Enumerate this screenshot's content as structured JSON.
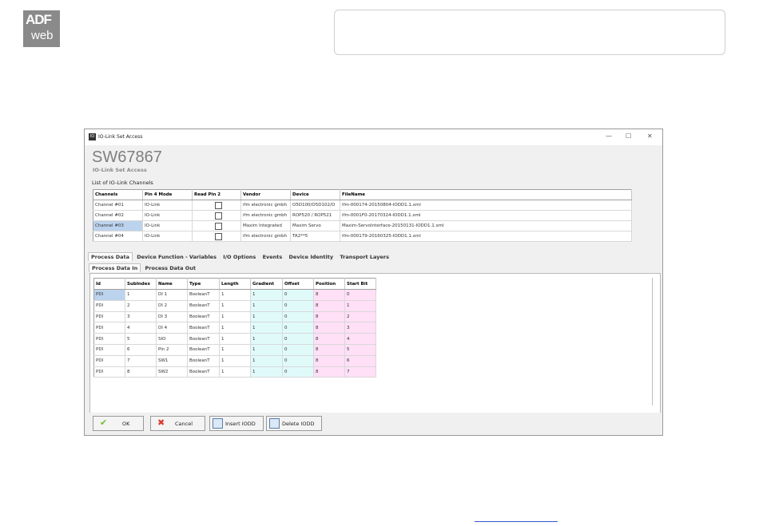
{
  "logo": {
    "line1": "ADF",
    "line2": "web"
  },
  "window": {
    "title": "IO-Link Set Access",
    "app_icon": "IO",
    "controls": [
      "—",
      "☐",
      "✕"
    ],
    "product_code": "SW67867",
    "product_subtitle": "IO-Link Set Access",
    "list_label": "List of IO-Link Channels"
  },
  "channels": {
    "headers": [
      "Channels",
      "Pin 4 Mode",
      "Read Pin 2",
      "Vendor",
      "Device",
      "FileName"
    ],
    "rows": [
      {
        "channel": "Channel #01",
        "mode": "IO-Link",
        "vendor": "ifm electronic gmbh",
        "device": "O5D100/O5D102/O",
        "file": "ifm-000174-20150804-IODD1.1.xml"
      },
      {
        "channel": "Channel #02",
        "mode": "IO-Link",
        "vendor": "ifm electronic gmbh",
        "device": "ROP520 / ROP521",
        "file": "ifm-0001F0-20170324-IODD1.1.xml"
      },
      {
        "channel": "Channel #03",
        "mode": "IO-Link",
        "vendor": "Maxim Integrated",
        "device": "Maxim Servo",
        "file": "Maxim-ServoInterface-20150131-IODD1.1.xml"
      },
      {
        "channel": "Channel #04",
        "mode": "IO-Link",
        "vendor": "ifm electronic gmbh",
        "device": "TA2**5",
        "file": "ifm-000179-20160325-IODD1.1.xml"
      }
    ]
  },
  "tabs": [
    "Process Data",
    "Device Function - Variables",
    "I/O Options",
    "Events",
    "Device Identity",
    "Transport Layers"
  ],
  "subtabs": [
    "Process Data In",
    "Process Data Out"
  ],
  "process_data": {
    "headers": [
      "Id",
      "SubIndex",
      "Name",
      "Type",
      "Length",
      "Gradient",
      "Offset",
      "Position",
      "Start Bit"
    ],
    "rows": [
      [
        "PDI",
        "1",
        "DI 1",
        "BooleanT",
        "1",
        "1",
        "0",
        "8",
        "0"
      ],
      [
        "PDI",
        "2",
        "DI 2",
        "BooleanT",
        "1",
        "1",
        "0",
        "8",
        "1"
      ],
      [
        "PDI",
        "3",
        "DI 3",
        "BooleanT",
        "1",
        "1",
        "0",
        "8",
        "2"
      ],
      [
        "PDI",
        "4",
        "DI 4",
        "BooleanT",
        "1",
        "1",
        "0",
        "8",
        "3"
      ],
      [
        "PDI",
        "5",
        "SIO",
        "BooleanT",
        "1",
        "1",
        "0",
        "8",
        "4"
      ],
      [
        "PDI",
        "6",
        "Pin 2",
        "BooleanT",
        "1",
        "1",
        "0",
        "8",
        "5"
      ],
      [
        "PDI",
        "7",
        "SW1",
        "BooleanT",
        "1",
        "1",
        "0",
        "8",
        "6"
      ],
      [
        "PDI",
        "8",
        "SW2",
        "BooleanT",
        "1",
        "1",
        "0",
        "8",
        "7"
      ]
    ]
  },
  "buttons": {
    "ok": "OK",
    "cancel": "Cancel",
    "insert": "Insert IODD",
    "delete": "Delete IODD"
  },
  "colors": {
    "selected": "#bcd3ee",
    "cyan_col": "#e0fafa",
    "pink_col": "#ffe0f6"
  }
}
